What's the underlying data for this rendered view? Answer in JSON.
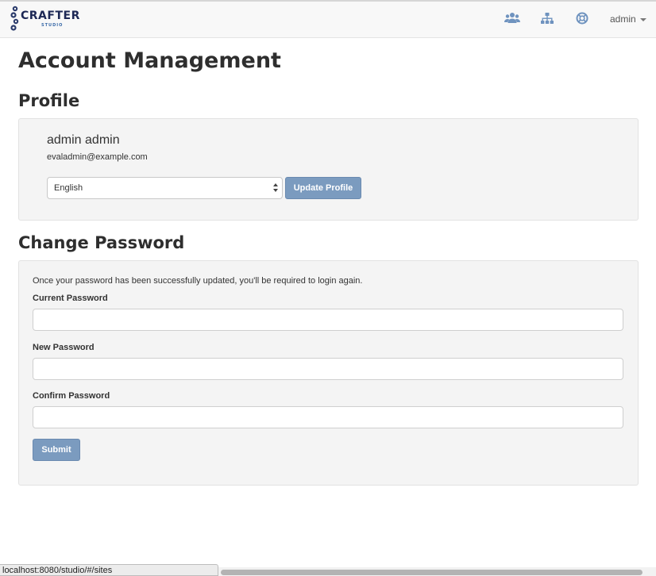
{
  "navbar": {
    "logo_text": "CRAFTER",
    "logo_subtext": "STUDIO",
    "user_label": "admin",
    "icons": [
      "users-icon",
      "sitemap-icon",
      "help-lifebuoy-icon"
    ]
  },
  "page": {
    "title": "Account Management"
  },
  "profile": {
    "heading": "Profile",
    "name": "admin admin",
    "email": "evaladmin@example.com",
    "language_selected": "English",
    "update_button": "Update Profile"
  },
  "password": {
    "heading": "Change Password",
    "note": "Once your password has been successfully updated, you'll be required to login again.",
    "current_label": "Current Password",
    "current_value": "",
    "new_label": "New Password",
    "new_value": "",
    "confirm_label": "Confirm Password",
    "confirm_value": "",
    "submit_button": "Submit"
  },
  "statusbar": {
    "url": "localhost:8080/studio/#/sites"
  },
  "colors": {
    "button": "#7b9bbf",
    "icon": "#6f93bf",
    "logo_dark": "#1d2855",
    "well_bg": "#f4f4f4"
  }
}
